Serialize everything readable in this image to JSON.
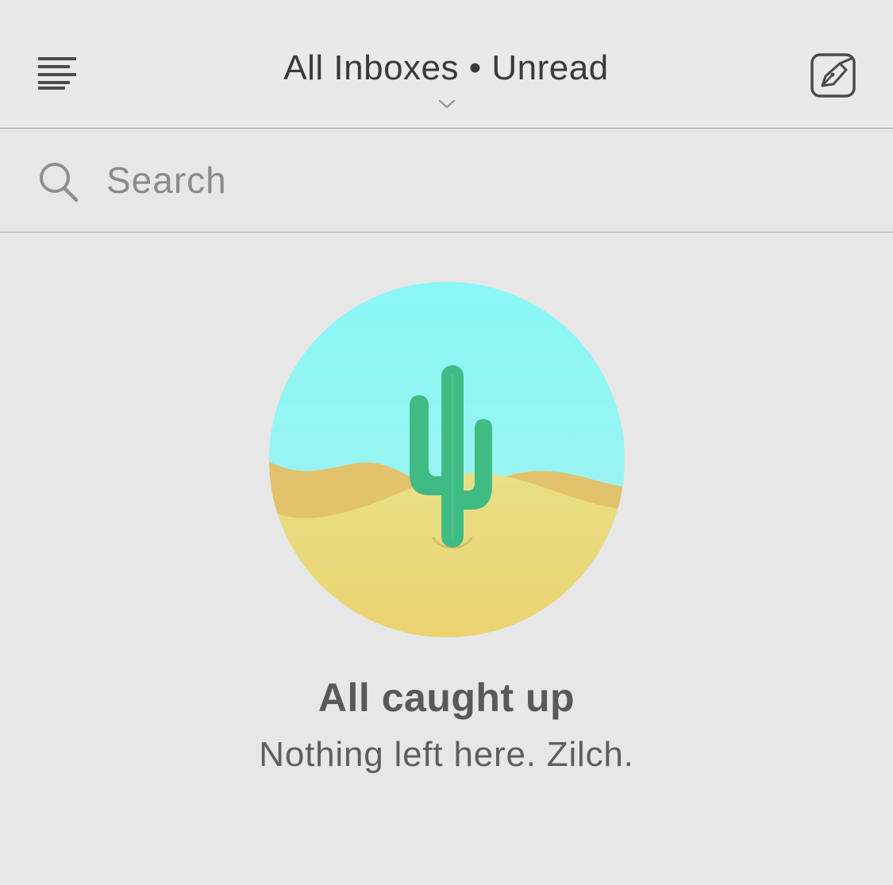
{
  "header": {
    "title": "All Inboxes • Unread",
    "menu_icon": "hamburger-menu-icon",
    "dropdown_icon": "chevron-down-icon",
    "compose_icon": "compose-pen-icon"
  },
  "search": {
    "placeholder": "Search",
    "value": "",
    "icon": "search-icon"
  },
  "empty_state": {
    "illustration": "desert-cactus-illustration",
    "title": "All caught up",
    "subtitle": "Nothing left here. Zilch."
  },
  "colors": {
    "background": "#e7e7e7",
    "sky": "#8af7f7",
    "sand": "#ecd77c",
    "dune": "#e2c16a",
    "cactus": "#3fbb83",
    "text_primary": "#3a3a3a",
    "text_secondary": "#5e5e5e"
  }
}
